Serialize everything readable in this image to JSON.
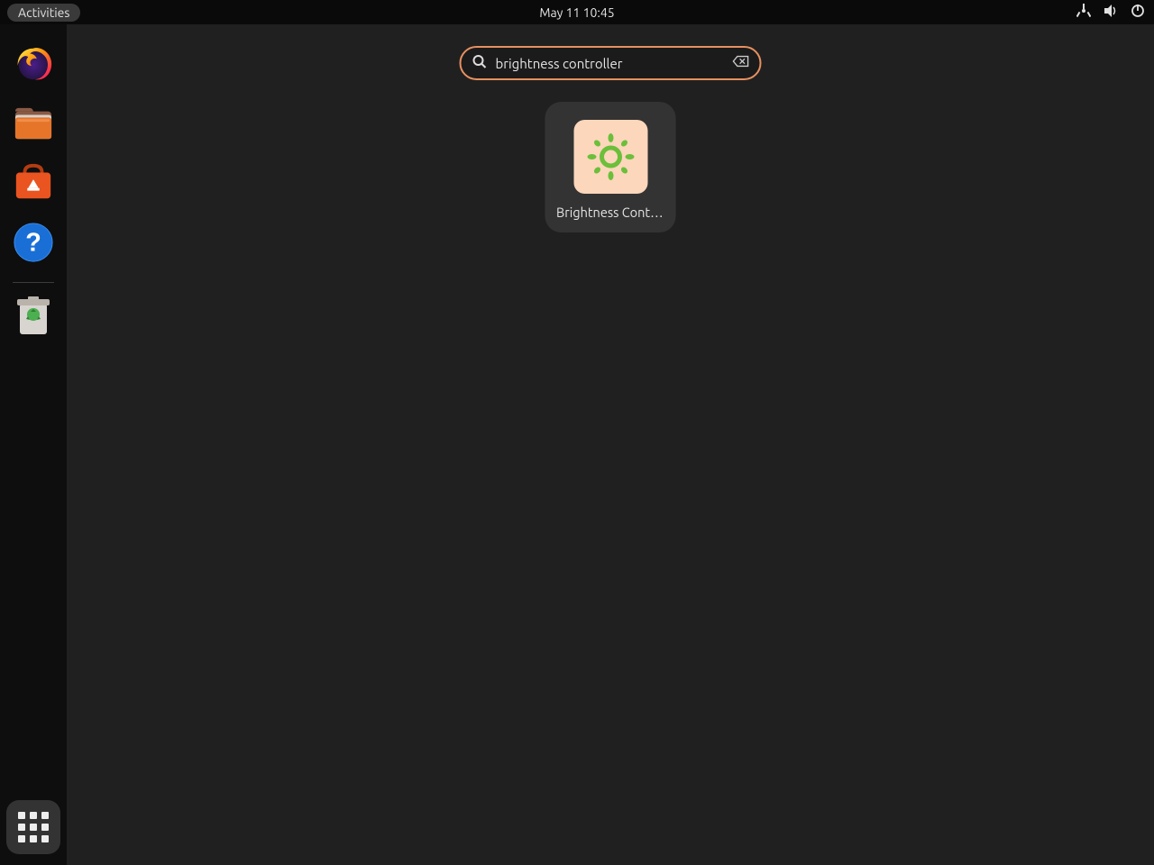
{
  "topbar": {
    "activities_label": "Activities",
    "datetime": "May 11  10:45"
  },
  "search": {
    "value": "brightness controller"
  },
  "result": {
    "label": "Brightness Controller"
  },
  "dock": {
    "items": [
      {
        "name": "firefox",
        "label": "Firefox"
      },
      {
        "name": "files",
        "label": "Files"
      },
      {
        "name": "software",
        "label": "Ubuntu Software"
      },
      {
        "name": "help",
        "label": "Help"
      }
    ],
    "trash_label": "Trash",
    "show_apps_label": "Show Applications"
  }
}
